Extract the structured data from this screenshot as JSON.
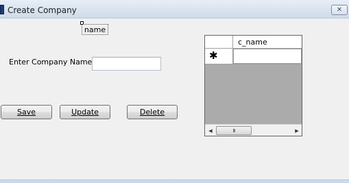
{
  "window": {
    "title": "Create Company",
    "close_glyph": "✕",
    "icon": "app-icon"
  },
  "form": {
    "name_label": "name",
    "prompt_label": "Enter Company Name :",
    "company_name_value": ""
  },
  "buttons": {
    "save": "Save",
    "update": "Update",
    "delete": "Delete"
  },
  "grid": {
    "columns": [
      "c_name"
    ],
    "new_row_marker": "✱",
    "rows": [],
    "scroll_left": "◀",
    "scroll_right": "▶",
    "thumb_grip": "III"
  }
}
